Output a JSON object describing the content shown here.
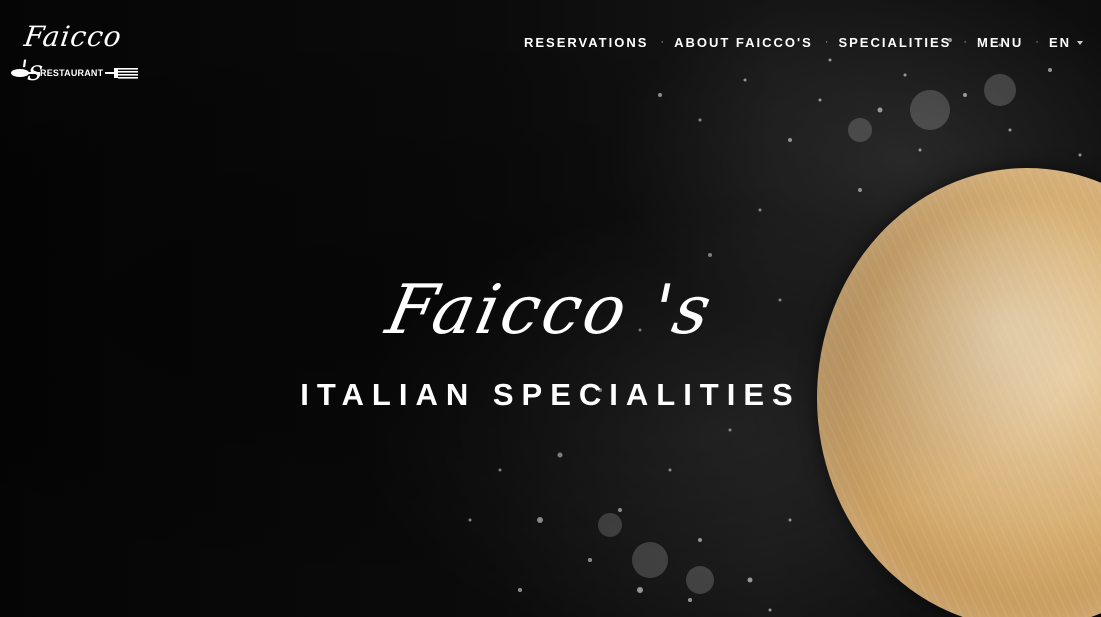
{
  "logo": {
    "script_text": "Faicco 's",
    "word": "RESTAURANT"
  },
  "nav": {
    "items": [
      {
        "label": "RESERVATIONS"
      },
      {
        "label": "ABOUT FAICCO'S"
      },
      {
        "label": "SPECIALITIES"
      },
      {
        "label": "MENU"
      },
      {
        "label": "EN"
      }
    ],
    "separator": "·"
  },
  "hero": {
    "title": "Faicco 's",
    "subtitle": "ITALIAN SPECIALITIES"
  },
  "icons": {
    "language_caret": "chevron-down-icon",
    "logo_cutlery": "spoon-fork-icon"
  },
  "colors": {
    "background": "#0b0b0b",
    "text": "#ffffff",
    "bread": "#d5ab6a"
  }
}
